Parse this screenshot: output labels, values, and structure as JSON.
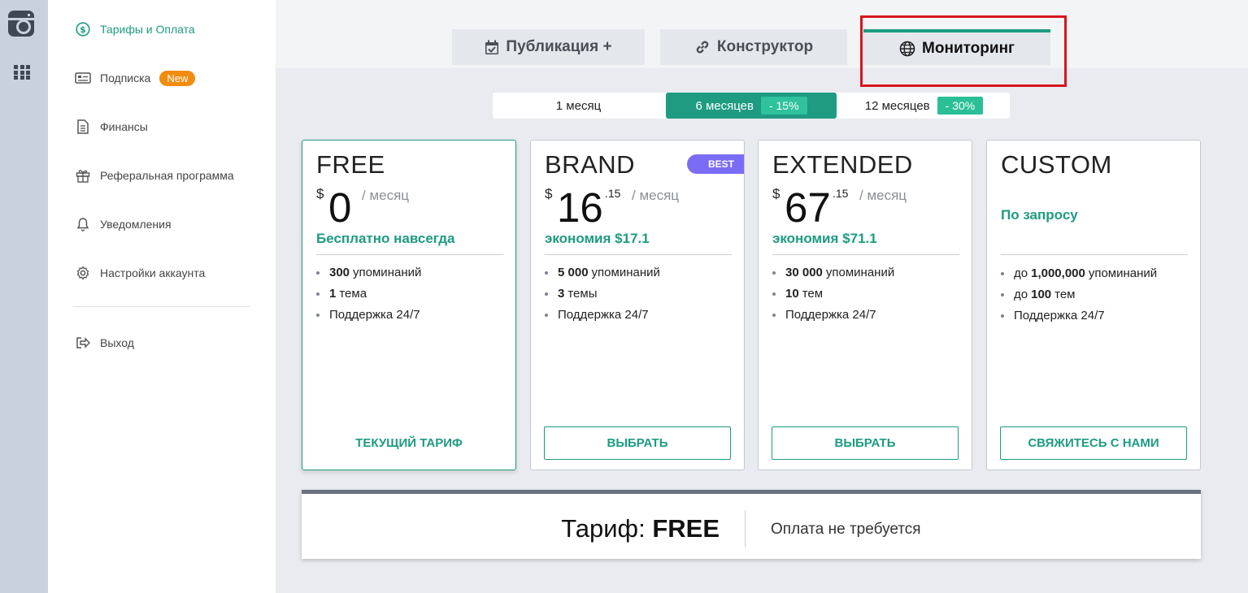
{
  "sidebar": {
    "items": [
      {
        "label": "Тарифы и Оплата"
      },
      {
        "label": "Подписка",
        "badge": "New"
      },
      {
        "label": "Финансы"
      },
      {
        "label": "Реферальная программа"
      },
      {
        "label": "Уведомления"
      },
      {
        "label": "Настройки аккаунта"
      },
      {
        "label": "Выход"
      }
    ]
  },
  "tabs": [
    {
      "label": "Публикация +",
      "icon": "calendar-check-icon"
    },
    {
      "label": "Конструктор",
      "icon": "link-icon"
    },
    {
      "label": "Мониторинг",
      "icon": "globe-icon"
    }
  ],
  "period": [
    {
      "label": "1 месяц"
    },
    {
      "label": "6 месяцев",
      "discount": "- 15%"
    },
    {
      "label": "12 месяцев",
      "discount": "- 30%"
    }
  ],
  "plans": [
    {
      "name": "FREE",
      "currency": "$",
      "amount": "0",
      "cents": "",
      "per": "/ месяц",
      "sub": "Бесплатно навсегда",
      "features": [
        {
          "bold": "300",
          "text": "упоминаний"
        },
        {
          "bold": "1",
          "text": "тема"
        },
        {
          "bold": "",
          "text": "Поддержка 24/7"
        }
      ],
      "button": "ТЕКУЩИЙ ТАРИФ"
    },
    {
      "name": "BRAND",
      "badge": "BEST",
      "currency": "$",
      "amount": "16",
      "cents": ".15",
      "per": "/ месяц",
      "sub": "экономия $17.1",
      "features": [
        {
          "bold": "5 000",
          "text": "упоминаний"
        },
        {
          "bold": "3",
          "text": "темы"
        },
        {
          "bold": "",
          "text": "Поддержка 24/7"
        }
      ],
      "button": "ВЫБРАТЬ"
    },
    {
      "name": "EXTENDED",
      "currency": "$",
      "amount": "67",
      "cents": ".15",
      "per": "/ месяц",
      "sub": "экономия $71.1",
      "features": [
        {
          "bold": "30 000",
          "text": "упоминаний"
        },
        {
          "bold": "10",
          "text": "тем"
        },
        {
          "bold": "",
          "text": "Поддержка 24/7"
        }
      ],
      "button": "ВЫБРАТЬ"
    },
    {
      "name": "CUSTOM",
      "sub": "По запросу",
      "features": [
        {
          "pre": "до",
          "bold": "1,000,000",
          "text": "упоминаний"
        },
        {
          "pre": "до",
          "bold": "100",
          "text": "тем"
        },
        {
          "bold": "",
          "text": "Поддержка 24/7"
        }
      ],
      "button": "СВЯЖИТЕСЬ С НАМИ"
    }
  ],
  "summary": {
    "prefix": "Тариф:",
    "plan": "FREE",
    "note": "Оплата не требуется"
  },
  "colors": {
    "accent": "#1e9b81",
    "badge_new": "#f28c0f",
    "badge_best": "#7b6cf6",
    "highlight": "#d8151d"
  }
}
